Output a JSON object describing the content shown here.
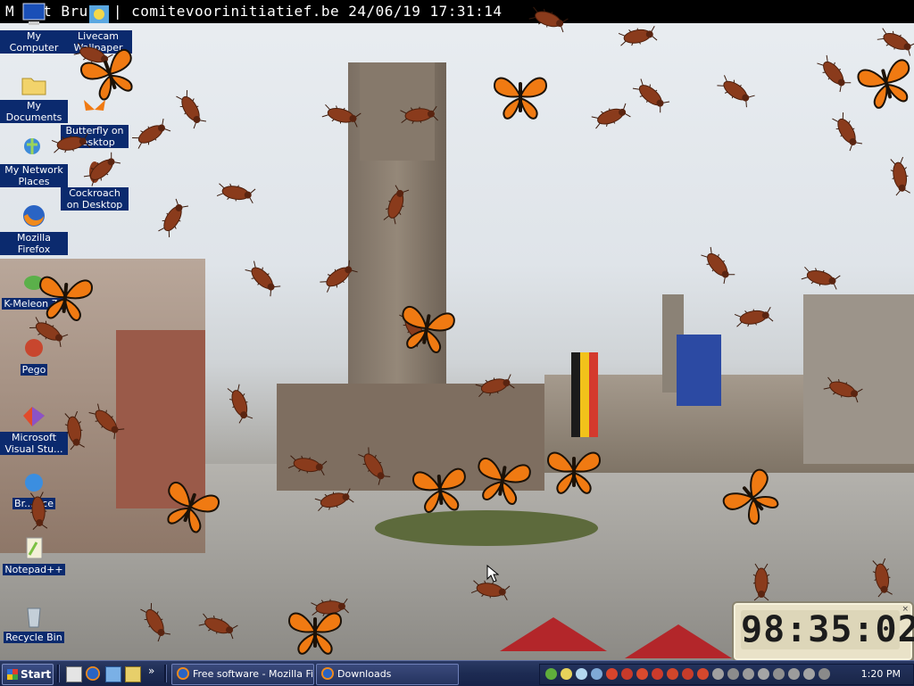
{
  "webcam": {
    "caption_left": "M",
    "caption_mid": "t Bru",
    "caption_main": "| comitevoorinitiatief.be 24/06/19 17:31:14"
  },
  "desktop": {
    "icons": [
      {
        "label": "My Computer",
        "icon": "computer-icon"
      },
      {
        "label": "Livecam Wallpaper",
        "icon": "livecam-icon"
      },
      {
        "label": "My Documents",
        "icon": "folder-icon"
      },
      {
        "label": "Butterfly on Desktop",
        "icon": "butterfly-app-icon"
      },
      {
        "label": "My Network Places",
        "icon": "network-icon"
      },
      {
        "label": "Cockroach on Desktop",
        "icon": "cockroach-app-icon"
      },
      {
        "label": "Mozilla Firefox",
        "icon": "firefox-icon"
      },
      {
        "label": "K-Meleon 74",
        "icon": "kmeleon-icon"
      },
      {
        "label": "Pego",
        "icon": "pego-icon"
      },
      {
        "label": "Microsoft Visual Stu...",
        "icon": "visual-studio-icon"
      },
      {
        "label": "Br...vice",
        "icon": "ie-icon"
      },
      {
        "label": "Notepad++",
        "icon": "notepadpp-icon"
      },
      {
        "label": "Recycle Bin",
        "icon": "recycle-bin-icon"
      }
    ]
  },
  "clock": {
    "time": "98:35:02"
  },
  "taskbar": {
    "start_label": "Start",
    "tasks": [
      {
        "label": "Free software - Mozilla Fir...",
        "icon": "firefox-icon"
      },
      {
        "label": "Downloads",
        "icon": "firefox-icon"
      }
    ],
    "tray_time": "1:20 PM"
  },
  "colors": {
    "taskbar": "#1d2b52",
    "icon_label_bg": "#0b2a6e",
    "roach": "#8a3b1c",
    "butterfly": "#f07a12"
  }
}
